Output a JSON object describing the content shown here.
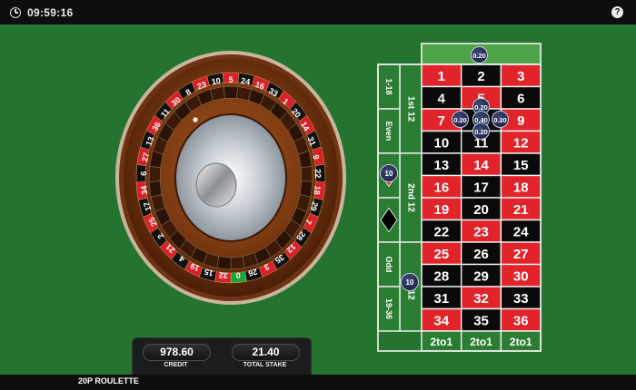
{
  "header": {
    "time": "09:59:16",
    "help_label": "?",
    "clock_icon": "clock-icon",
    "help_icon": "help-icon"
  },
  "footer": {
    "game_name": "20P ROULETTE"
  },
  "panel": {
    "credit_value": "978.60",
    "credit_label": "CREDIT",
    "stake_value": "21.40",
    "stake_label": "TOTAL STAKE"
  },
  "wheel": {
    "numbers": [
      "0",
      "32",
      "15",
      "19",
      "4",
      "21",
      "2",
      "25",
      "17",
      "34",
      "6",
      "27",
      "13",
      "36",
      "11",
      "30",
      "8",
      "23",
      "10",
      "5",
      "24",
      "16",
      "33",
      "1",
      "20",
      "14",
      "31",
      "9",
      "22",
      "18",
      "29",
      "7",
      "28",
      "12",
      "35",
      "3",
      "26"
    ]
  },
  "table": {
    "zero": "0",
    "rows": [
      [
        "1",
        "2",
        "3"
      ],
      [
        "4",
        "5",
        "6"
      ],
      [
        "7",
        "8",
        "9"
      ],
      [
        "10",
        "11",
        "12"
      ],
      [
        "13",
        "14",
        "15"
      ],
      [
        "16",
        "17",
        "18"
      ],
      [
        "19",
        "20",
        "21"
      ],
      [
        "22",
        "23",
        "24"
      ],
      [
        "25",
        "26",
        "27"
      ],
      [
        "28",
        "29",
        "30"
      ],
      [
        "31",
        "32",
        "33"
      ],
      [
        "34",
        "35",
        "36"
      ]
    ],
    "red_numbers": [
      1,
      3,
      5,
      7,
      9,
      12,
      14,
      16,
      18,
      19,
      21,
      23,
      25,
      27,
      30,
      32,
      34,
      36
    ],
    "dozens": [
      "1st 12",
      "2nd 12",
      "3rd 12"
    ],
    "outside": [
      "1-18",
      "Even",
      "Odd",
      "19-36"
    ],
    "columns": [
      "2to1",
      "2to1",
      "2to1"
    ]
  },
  "chips": {
    "zero": "0.20",
    "corner_top": "0.20",
    "corner_left": "0.20",
    "corner_center": "0.40",
    "corner_right": "0.20",
    "corner_bottom": "0.20",
    "red_bet": "10",
    "third_dozen": "10"
  },
  "colors": {
    "felt": "#24742f",
    "red": "#e0242a",
    "black": "#0a0a0a",
    "chip": "#1d254a"
  }
}
